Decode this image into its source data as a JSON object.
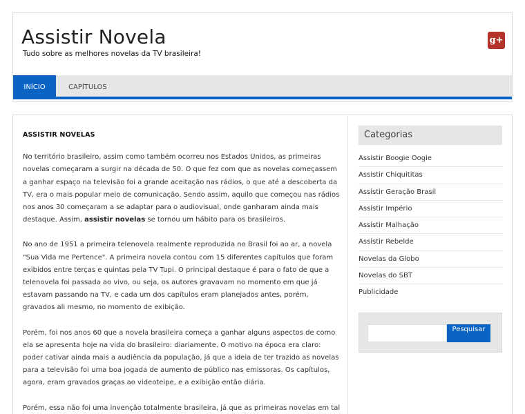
{
  "site": {
    "title": "Assistir Novela",
    "tagline": "Tudo sobre as melhores novelas da TV brasileira!",
    "gplus_glyph": "g+"
  },
  "nav": {
    "items": [
      {
        "label": "INÍCIO",
        "active": true
      },
      {
        "label": "CAPÍTULOS",
        "active": false
      }
    ]
  },
  "article": {
    "title": "ASSISTIR NOVELAS",
    "p1_text": "No território brasileiro, assim como também ocorreu nos Estados Unidos, as primeiras novelas começaram a surgir na década de 50. O que fez com que as novelas começassem a ganhar espaço na televisão foi a grande aceitação nas rádios, o que até a descoberta da TV, era o mais popular meio de comunicação. Sendo assim, aquilo que começou nas rádios nos anos 30 começaram a se adaptar para o audiovisual, onde ganharam ainda mais destaque. Assim,",
    "p1_bold": "assistir novelas",
    "p1_tail": "se tornou um hábito para os brasileiros.",
    "p2": "No ano de 1951 a primeira telenovela realmente reproduzida no Brasil foi ao ar, a novela \"Sua Vida me Pertence\". A primeira novela contou com 15 diferentes capítulos que foram exibidos entre terças e quintas pela TV Tupi. O principal destaque é para o fato de que a telenovela foi passada ao vivo, ou seja, os autores gravavam no momento em que já estavam passando na TV, e cada um dos capítulos eram planejados antes, porém, gravados ali mesmo, no momento de exibição.",
    "p3": "Porém, foi nos anos 60 que a novela brasileira começa a ganhar alguns aspectos de como ela se apresenta hoje na vida do brasileiro: diariamente. O motivo na época era claro: poder cativar ainda mais a audiência da população, já que a ideia de ter trazido as novelas para a televisão foi uma boa jogada de aumento de público nas emissoras. Os capítulos, agora, eram gravados graças ao videoteipe, e a exibição então diária.",
    "p4": "Porém, essa não foi uma invenção totalmente brasileira, já que as primeiras novelas em tal"
  },
  "sidebar": {
    "categories_title": "Categorias",
    "categories": [
      "Assistir Boogie Oogie",
      "Assistir Chiquititas",
      "Assistir Geração Brasil",
      "Assistir Império",
      "Assistir Malhação",
      "Assistir Rebelde",
      "Novelas da Globo",
      "Novelas do SBT",
      "Publicidade"
    ],
    "search_value": "",
    "search_button": "Pesquisar"
  },
  "colors": {
    "accent": "#0b63c4",
    "nav_bg": "#e6e6e6",
    "gplus": "#b5332a"
  }
}
